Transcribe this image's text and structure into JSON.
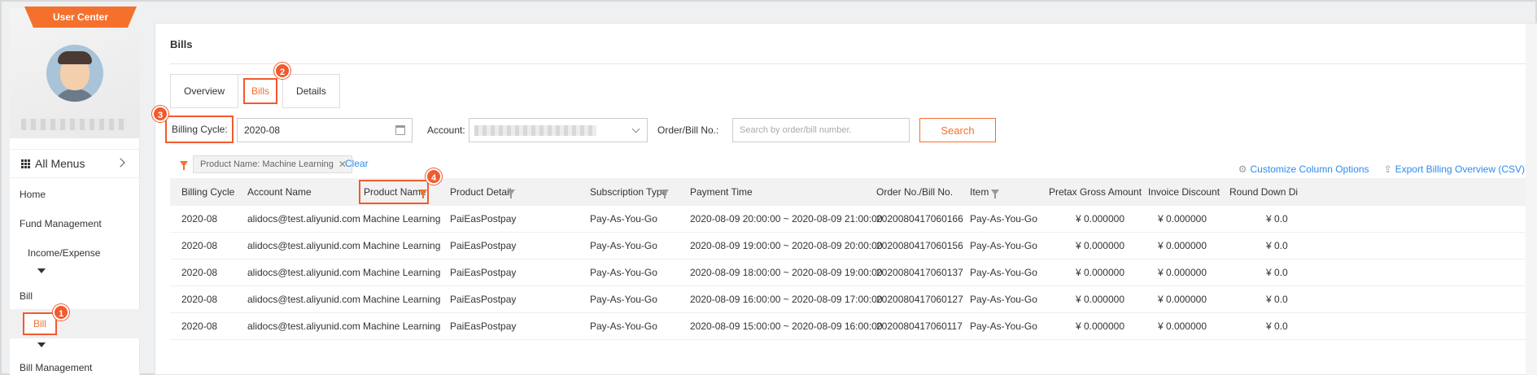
{
  "sidebar": {
    "user_center_label": "User Center",
    "all_menus_label": "All Menus",
    "items": {
      "home": "Home",
      "fund_management": "Fund Management",
      "income_expense": "Income/Expense",
      "bill": "Bill",
      "bill_active": "Bill",
      "bill_management": "Bill Management"
    },
    "colors": {
      "accent": "#f5702d",
      "highlight": "#f25a2f"
    }
  },
  "page": {
    "title": "Bills",
    "tabs": [
      {
        "label": "Overview"
      },
      {
        "label": "Bills"
      },
      {
        "label": "Details"
      }
    ]
  },
  "filters": {
    "billing_cycle_label": "Billing Cycle:",
    "billing_cycle_value": "2020-08",
    "account_label": "Account:",
    "order_label": "Order/Bill No.:",
    "order_placeholder": "Search by order/bill number.",
    "search_button": "Search",
    "active_filter_tag": "Product Name: Machine Learning",
    "clear_label": "Clear",
    "customize_label": "Customize Column Options",
    "export_label": "Export Billing Overview (CSV)"
  },
  "badges": {
    "one": "1",
    "two": "2",
    "three": "3",
    "four": "4"
  },
  "table": {
    "headers": {
      "billing_cycle": "Billing Cycle",
      "account_name": "Account Name",
      "product_name": "Product Name",
      "product_detail": "Product Detail",
      "subscription_type": "Subscription Type",
      "payment_time": "Payment Time",
      "order_no": "Order No./Bill No.",
      "item": "Item",
      "pretax_gross": "Pretax Gross Amount",
      "invoice_discount": "Invoice Discount",
      "round_down": "Round Down Di"
    },
    "rows": [
      {
        "cycle": "2020-08",
        "account": "alidocs@test.aliyunid.com",
        "product": "Machine Learning",
        "detail": "PaiEasPostpay",
        "sub": "Pay-As-You-Go",
        "time": "2020-08-09 20:00:00  ~  2020-08-09 21:00:00",
        "order": "2020080417060166",
        "item": "Pay-As-You-Go",
        "gross": "¥ 0.000000",
        "discount": "¥ 0.000000",
        "round": "¥ 0.0"
      },
      {
        "cycle": "2020-08",
        "account": "alidocs@test.aliyunid.com",
        "product": "Machine Learning",
        "detail": "PaiEasPostpay",
        "sub": "Pay-As-You-Go",
        "time": "2020-08-09 19:00:00  ~  2020-08-09 20:00:00",
        "order": "2020080417060156",
        "item": "Pay-As-You-Go",
        "gross": "¥ 0.000000",
        "discount": "¥ 0.000000",
        "round": "¥ 0.0"
      },
      {
        "cycle": "2020-08",
        "account": "alidocs@test.aliyunid.com",
        "product": "Machine Learning",
        "detail": "PaiEasPostpay",
        "sub": "Pay-As-You-Go",
        "time": "2020-08-09 18:00:00  ~  2020-08-09 19:00:00",
        "order": "2020080417060137",
        "item": "Pay-As-You-Go",
        "gross": "¥ 0.000000",
        "discount": "¥ 0.000000",
        "round": "¥ 0.0"
      },
      {
        "cycle": "2020-08",
        "account": "alidocs@test.aliyunid.com",
        "product": "Machine Learning",
        "detail": "PaiEasPostpay",
        "sub": "Pay-As-You-Go",
        "time": "2020-08-09 16:00:00  ~  2020-08-09 17:00:00",
        "order": "2020080417060127",
        "item": "Pay-As-You-Go",
        "gross": "¥ 0.000000",
        "discount": "¥ 0.000000",
        "round": "¥ 0.0"
      },
      {
        "cycle": "2020-08",
        "account": "alidocs@test.aliyunid.com",
        "product": "Machine Learning",
        "detail": "PaiEasPostpay",
        "sub": "Pay-As-You-Go",
        "time": "2020-08-09 15:00:00  ~  2020-08-09 16:00:00",
        "order": "2020080417060117",
        "item": "Pay-As-You-Go",
        "gross": "¥ 0.000000",
        "discount": "¥ 0.000000",
        "round": "¥ 0.0"
      }
    ]
  }
}
